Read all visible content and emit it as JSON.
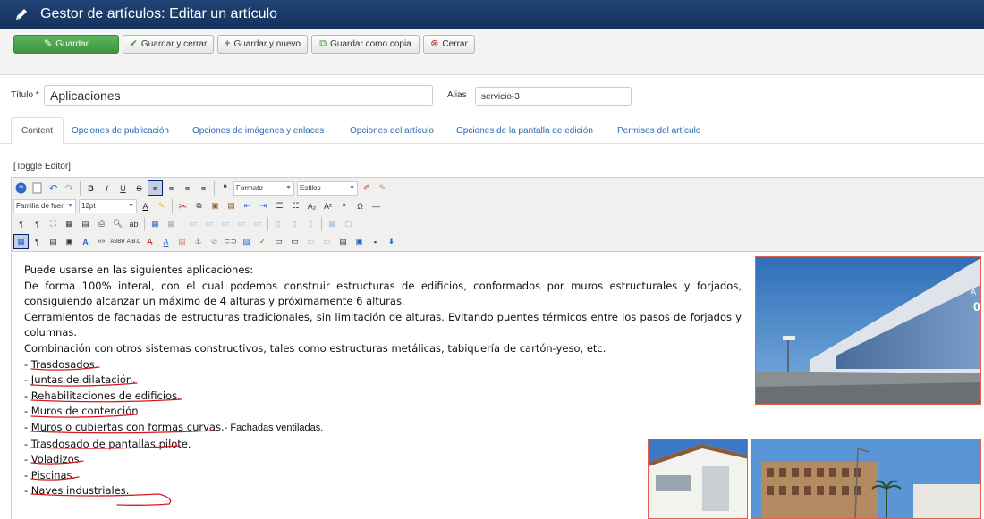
{
  "header": {
    "title": "Gestor de artículos: Editar un artículo",
    "icon": "pencil-icon"
  },
  "toolbar": {
    "save": "Guardar",
    "save_close": "Guardar y cerrar",
    "save_new": "Guardar y nuevo",
    "save_copy": "Guardar como copia",
    "close": "Cerrar"
  },
  "form": {
    "title_label": "Título *",
    "title_value": "Aplicaciones",
    "alias_label": "Alias",
    "alias_value": "servicio-3"
  },
  "tabs": [
    "Content",
    "Opciones de publicación",
    "Opciones de imágenes y enlaces",
    "Opciones del artículo",
    "Opciones de la pantalla de edición",
    "Permisos del artículo"
  ],
  "editor": {
    "toggle": "[Toggle Editor]",
    "format": "Formato",
    "styles": "Estilos",
    "font_family": "Familia de fuer",
    "font_size": "12pt"
  },
  "content": {
    "paragraphs": [
      "Puede usarse en las siguientes aplicaciones:",
      "De forma 100% interal, con el cual podemos construir estructuras de edificios, conformados por muros estructurales y forjados, consiguiendo alcanzar un máximo de 4 alturas y próximamente 6 alturas.",
      "Cerramientos de fachadas de estructuras tradicionales, sin limitación de alturas. Evitando puentes térmicos entre los pasos de forjados y columnas.",
      "Combinación con otros sistemas constructivos, tales como estructuras metálicas, tabiquería de cartón-yeso, etc."
    ],
    "list": [
      "- Trasdosados.",
      "- Juntas de dilatación.",
      "- Rehabilitaciones de edificios.",
      "- Muros de contención.",
      "- Muros o cubiertas con formas curvas.",
      "- Trasdosado de pantallas pilote.",
      "- Voladizos.",
      "- Piscinas.",
      "- Naves industriales."
    ],
    "list_tail": "- Fachadas ventiladas."
  },
  "colors": {
    "header_bg": "#1a3867",
    "save_green": "#46a546",
    "link_blue": "#2a69b8",
    "annotation_red": "#d9181e"
  }
}
